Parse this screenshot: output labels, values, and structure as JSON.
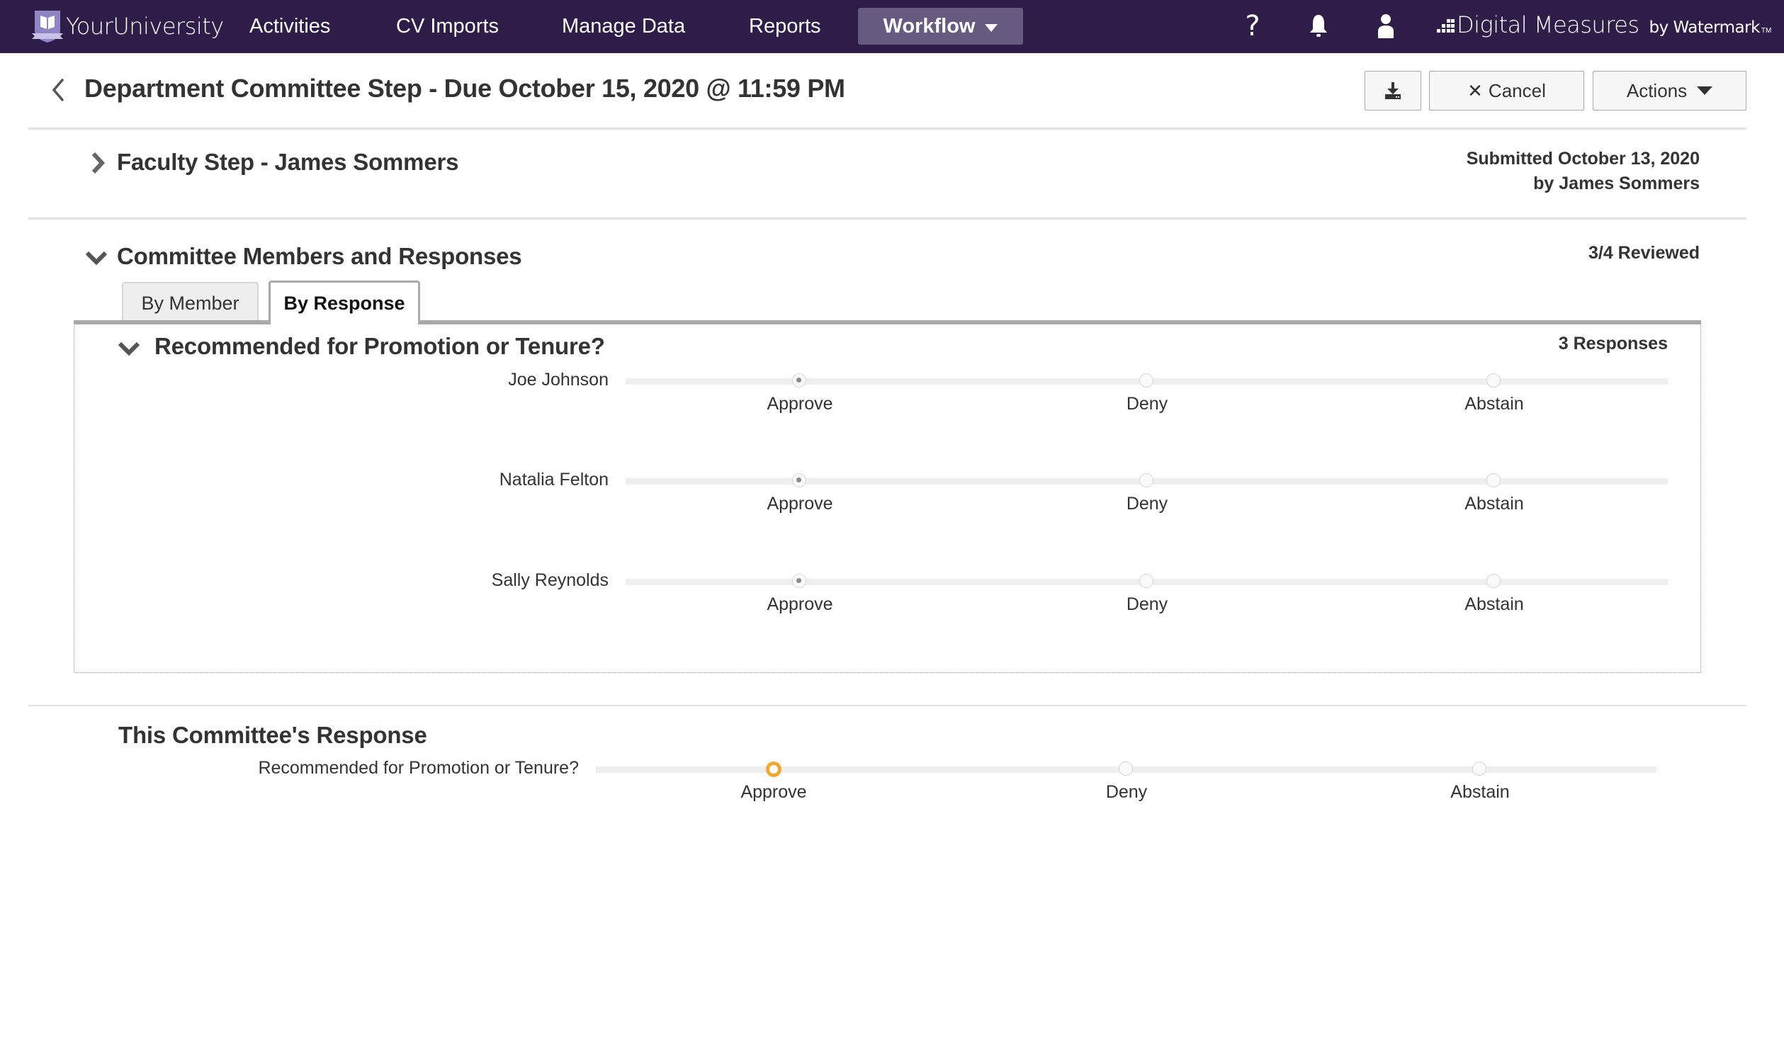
{
  "navbar": {
    "brand": "YourUniversity",
    "items": [
      {
        "label": "Activities"
      },
      {
        "label": "CV Imports"
      },
      {
        "label": "Manage Data"
      },
      {
        "label": "Reports"
      }
    ],
    "active_item": {
      "label": "Workflow"
    },
    "icons": [
      "help-icon",
      "bell-icon",
      "user-icon"
    ],
    "help_glyph": "?",
    "vendor": {
      "name": "Digital Measures",
      "by": "by Watermark",
      "tm": "TM"
    },
    "background_color": "#2e1d48",
    "active_color": "#675a80"
  },
  "header": {
    "title": "Department Committee Step - Due October 15, 2020 @ 11:59 PM",
    "buttons": {
      "download_icon": "download-icon",
      "cancel_label": "Cancel",
      "actions_label": "Actions"
    }
  },
  "faculty_step": {
    "title": "Faculty Step - James Sommers",
    "submitted_line1": "Submitted October 13, 2020",
    "submitted_line2": "by James Sommers",
    "expanded": false
  },
  "committee": {
    "title": "Committee Members and Responses",
    "reviewed": "3/4 Reviewed",
    "expanded": true,
    "tabs": [
      {
        "label": "By Member",
        "active": false
      },
      {
        "label": "By Response",
        "active": true
      }
    ],
    "question": {
      "title": "Recommended for Promotion or Tenure?",
      "count": "3 Responses",
      "options": [
        "Approve",
        "Deny",
        "Abstain"
      ],
      "responses": [
        {
          "name": "Joe Johnson",
          "selected": "Approve"
        },
        {
          "name": "Natalia Felton",
          "selected": "Approve"
        },
        {
          "name": "Sally Reynolds",
          "selected": "Approve"
        }
      ]
    }
  },
  "this_committee": {
    "title": "This Committee's Response",
    "question": "Recommended for Promotion or Tenure?",
    "options": [
      "Approve",
      "Deny",
      "Abstain"
    ],
    "selected": "Approve",
    "accent_color": "#f0a830"
  }
}
